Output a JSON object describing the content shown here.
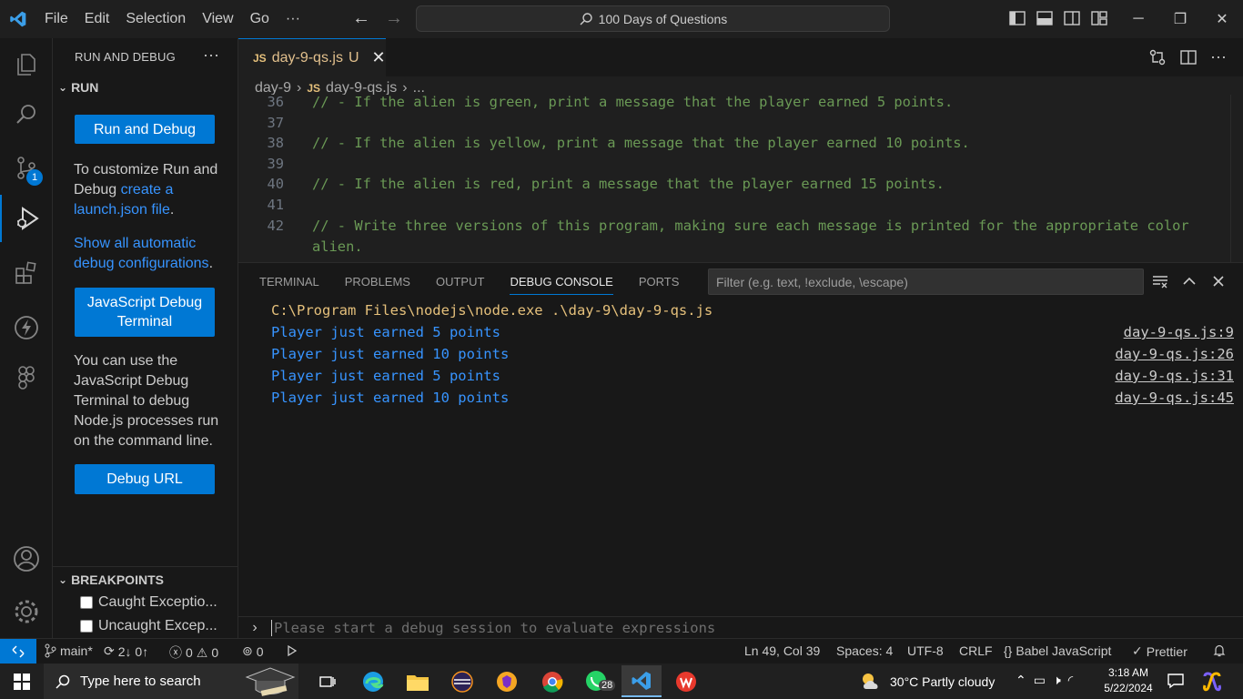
{
  "titlebar": {
    "menu": [
      "File",
      "Edit",
      "Selection",
      "View",
      "Go",
      "···"
    ],
    "search_text": "100 Days of Questions"
  },
  "activity": {
    "scm_badge": "1"
  },
  "sidebar": {
    "title": "RUN AND DEBUG",
    "more": "···",
    "section": "RUN",
    "run_button": "Run and Debug",
    "customize_pre": "To customize Run and Debug ",
    "customize_link": "create a launch.json file",
    "customize_post": ".",
    "show_all_link": "Show all automatic debug configurations",
    "show_all_post": ".",
    "js_terminal_button": "JavaScript Debug Terminal",
    "js_terminal_desc": "You can use the JavaScript Debug Terminal to debug Node.js processes run on the command line.",
    "debug_url_button": "Debug URL",
    "breakpoints_title": "BREAKPOINTS",
    "breakpoints": [
      "Caught Exceptio...",
      "Uncaught Excep..."
    ]
  },
  "editor": {
    "tab_icon": "JS",
    "tab_name": "day-9-qs.js",
    "tab_status": "U",
    "breadcrumb": [
      "day-9",
      "day-9-qs.js",
      "..."
    ],
    "lines": [
      {
        "n": "36",
        "t": "// - If the alien is green, print a message that the player earned 5 points."
      },
      {
        "n": "37",
        "t": ""
      },
      {
        "n": "38",
        "t": "// - If the alien is yellow, print a message that the player earned 10 points."
      },
      {
        "n": "39",
        "t": ""
      },
      {
        "n": "40",
        "t": "// - If the alien is red, print a message that the player earned 15 points."
      },
      {
        "n": "41",
        "t": ""
      },
      {
        "n": "42",
        "t": "// - Write three versions of this program, making sure each message is printed for the appropriate color"
      },
      {
        "n": "",
        "t": "alien."
      }
    ]
  },
  "panel": {
    "tabs": [
      "TERMINAL",
      "PROBLEMS",
      "OUTPUT",
      "DEBUG CONSOLE",
      "PORTS"
    ],
    "active_tab": "DEBUG CONSOLE",
    "filter_placeholder": "Filter (e.g. text, !exclude, \\escape)",
    "command": "C:\\Program Files\\nodejs\\node.exe .\\day-9\\day-9-qs.js",
    "output": [
      {
        "text": "Player just earned 5 points",
        "source": "day-9-qs.js:9"
      },
      {
        "text": "Player just earned 10 points",
        "source": "day-9-qs.js:26"
      },
      {
        "text": "Player just earned 5 points",
        "source": "day-9-qs.js:31"
      },
      {
        "text": "Player just earned 10 points",
        "source": "day-9-qs.js:45"
      }
    ],
    "eval_placeholder": "Please start a debug session to evaluate expressions"
  },
  "statusbar": {
    "branch": "main*",
    "sync": "2↓ 0↑",
    "errors": "0",
    "warnings": "0",
    "ports": "0",
    "position": "Ln 49, Col 39",
    "spaces": "Spaces: 4",
    "encoding": "UTF-8",
    "eol": "CRLF",
    "language": "Babel JavaScript",
    "formatter": "Prettier"
  },
  "taskbar": {
    "search_placeholder": "Type here to search",
    "whatsapp_badge": "28",
    "weather": "30°C  Partly cloudy",
    "time": "3:18 AM",
    "date": "5/22/2024"
  },
  "colors": {
    "accent": "#0078d4",
    "comment": "#6a9955",
    "output_blue": "#3794ff",
    "command_yellow": "#e5c07b"
  }
}
